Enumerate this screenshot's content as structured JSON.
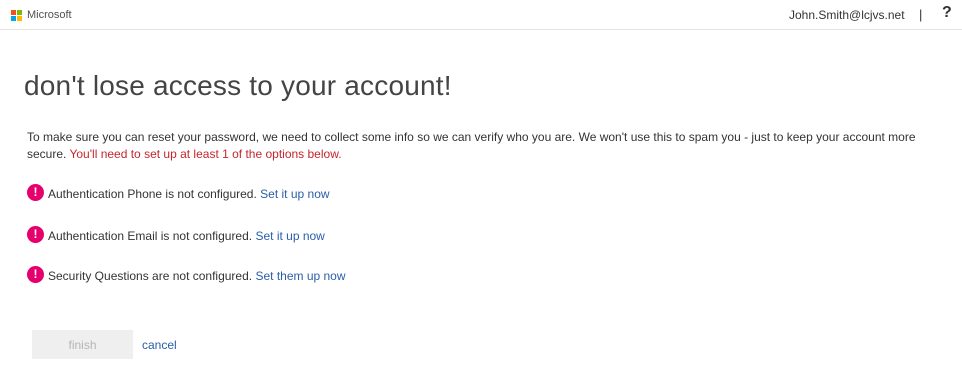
{
  "header": {
    "brand": "Microsoft",
    "user": "John.Smith@lcjvs.net",
    "separator": "|",
    "help": "?"
  },
  "main": {
    "title": "don't lose access to your account!",
    "intro": "To make sure you can reset your password, we need to collect some info so we can verify who you are. We won't use this to spam you - just to keep your account more secure.",
    "requirement": "You'll need to set up at least 1 of the options below.",
    "items": [
      {
        "text": "Authentication Phone is not configured.",
        "link": "Set it up now"
      },
      {
        "text": "Authentication Email is not configured.",
        "link": "Set it up now"
      },
      {
        "text": "Security Questions are not configured.",
        "link": "Set them up now"
      }
    ],
    "warning_icon": "!"
  },
  "actions": {
    "finish": "finish",
    "cancel": "cancel"
  },
  "colors": {
    "accent_link": "#2a5ea8",
    "warning": "#e5006e",
    "required_text": "#c4262e"
  },
  "icons": [
    "microsoft-logo-icon",
    "help-icon",
    "warning-icon"
  ]
}
